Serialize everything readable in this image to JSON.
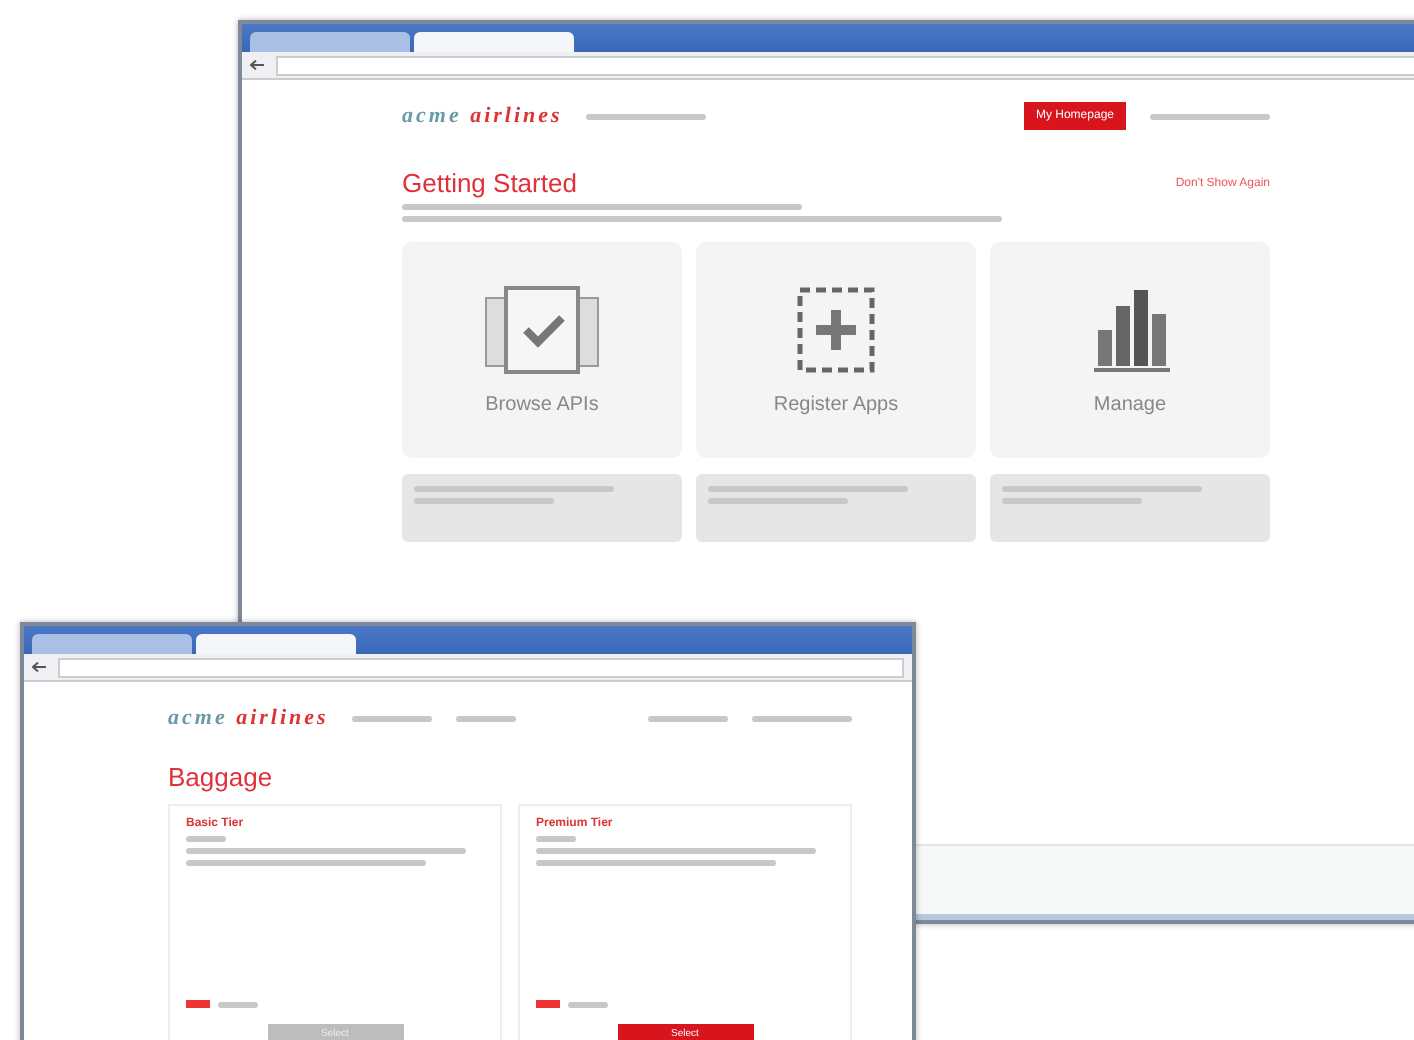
{
  "back_window": {
    "tabs": [
      {
        "selected": false
      },
      {
        "selected": true
      }
    ],
    "brand": {
      "first": "acme",
      "second": "airlines"
    },
    "homepage_button": "My Homepage",
    "title": "Getting Started",
    "dismiss": "Don't Show Again",
    "tiles": [
      {
        "kind": "browse",
        "label": "Browse APIs"
      },
      {
        "kind": "register",
        "label": "Register Apps"
      },
      {
        "kind": "manage",
        "label": "Manage"
      }
    ]
  },
  "front_window": {
    "tabs": [
      {
        "selected": false
      },
      {
        "selected": true
      }
    ],
    "brand": {
      "first": "acme",
      "second": "airlines"
    },
    "title": "Baggage",
    "tiers": [
      {
        "name": "Basic Tier",
        "button": "Select",
        "disabled": true
      },
      {
        "name": "Premium Tier",
        "button": "Select",
        "disabled": false
      }
    ]
  }
}
